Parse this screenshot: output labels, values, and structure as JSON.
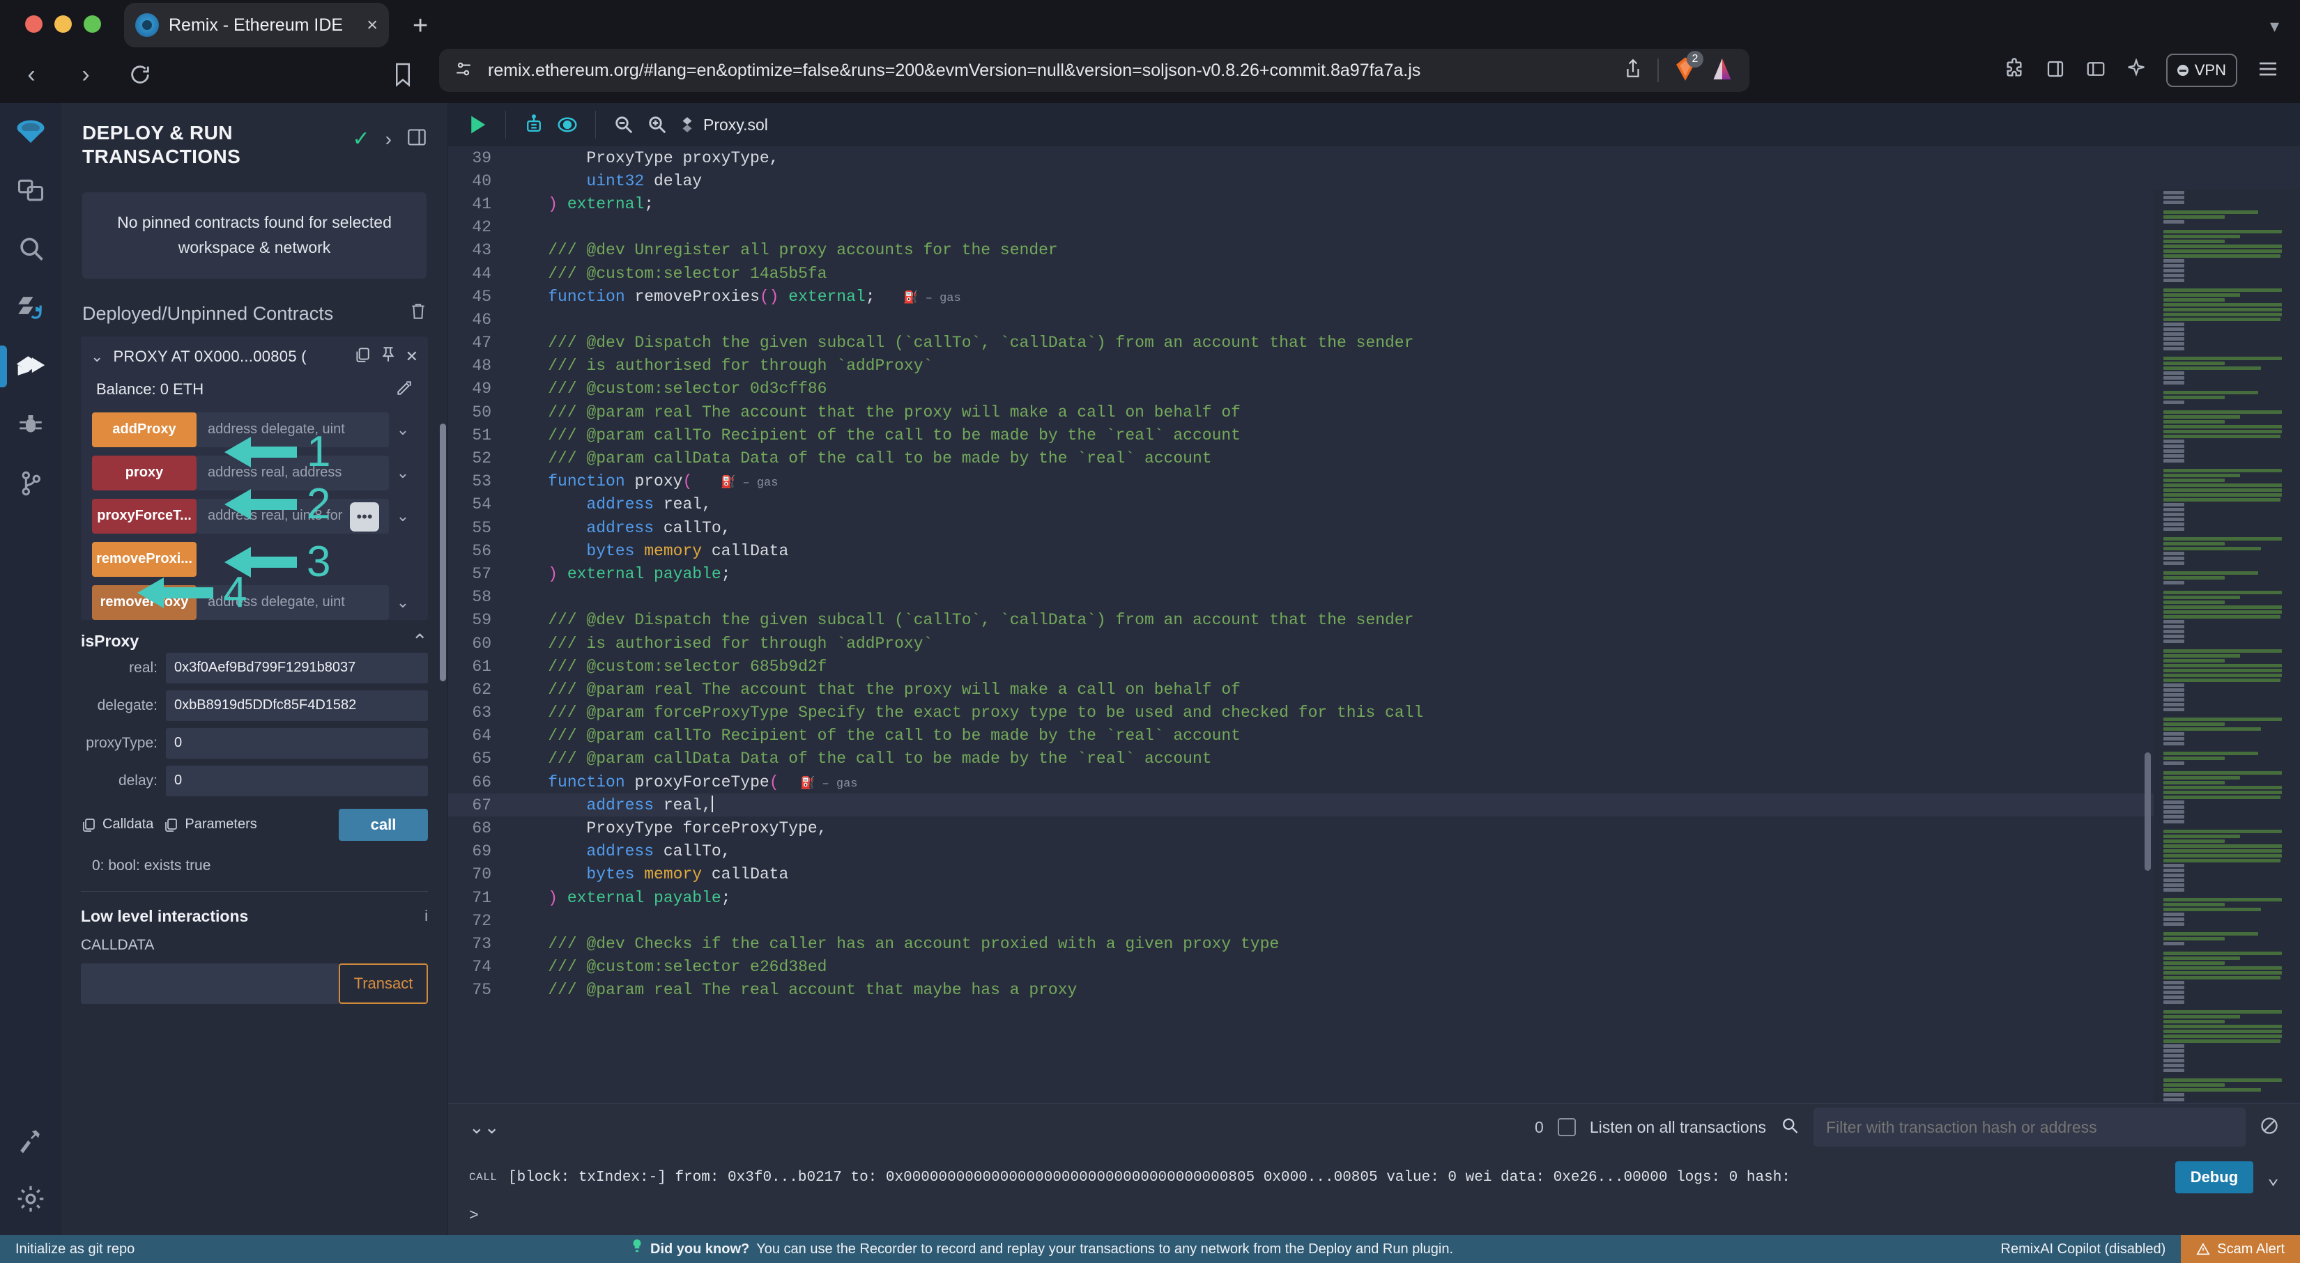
{
  "browser": {
    "tab": {
      "title": "Remix - Ethereum IDE",
      "favicon": "remix-logo-icon",
      "close": "×"
    },
    "new_tab": "+",
    "url": "remix.ethereum.org/#lang=en&optimize=false&runs=200&evmVersion=null&version=soljson-v0.8.26+commit.8a97fa7a.js",
    "extension_badge_count": "2",
    "vpn_label": "VPN"
  },
  "rail": {
    "items": [
      {
        "name": "remix-home-icon",
        "label": "Home"
      },
      {
        "name": "file-explorer-icon",
        "label": "File explorer"
      },
      {
        "name": "search-icon",
        "label": "Search in files"
      },
      {
        "name": "solidity-compiler-icon",
        "label": "Solidity compiler"
      },
      {
        "name": "deploy-run-icon",
        "label": "Deploy & run transactions"
      },
      {
        "name": "debugger-icon",
        "label": "Debugger"
      },
      {
        "name": "git-icon",
        "label": "Git"
      }
    ],
    "bottom": [
      {
        "name": "plugin-manager-icon",
        "label": "Plugin manager"
      },
      {
        "name": "settings-gear-icon",
        "label": "Settings"
      }
    ]
  },
  "panel": {
    "title": "DEPLOY & RUN TRANSACTIONS",
    "status_check": "✓",
    "expand_chevron": "›",
    "layout_icon": "panel-layout-icon",
    "pinned_message": "No pinned contracts found for selected workspace & network",
    "deployed_header": "Deployed/Unpinned Contracts",
    "contract": {
      "name": "PROXY AT 0X000...00805 (",
      "collapse_chevron": "⌄",
      "balance": "Balance: 0 ETH",
      "functions": [
        {
          "label": "addProxy",
          "color": "orange",
          "placeholder": "address delegate, uint",
          "has_input": true
        },
        {
          "label": "proxy",
          "color": "red",
          "placeholder": "address real, address",
          "has_input": true
        },
        {
          "label": "proxyForceT...",
          "color": "red",
          "placeholder": "address real, uint8 for",
          "has_input": true,
          "cursor": "•••"
        },
        {
          "label": "removeProxi...",
          "color": "orange",
          "placeholder": "",
          "has_input": false
        },
        {
          "label": "removeProxy",
          "color": "brown",
          "placeholder": "address delegate, uint",
          "has_input": true
        }
      ]
    },
    "isproxy": {
      "title": "isProxy",
      "collapse_chevron": "⌃",
      "params": [
        {
          "label": "real:",
          "value": "0x3f0Aef9Bd799F1291b8037"
        },
        {
          "label": "delegate:",
          "value": "0xbB8919d5DDfc85F4D1582"
        },
        {
          "label": "proxyType:",
          "value": "0"
        },
        {
          "label": "delay:",
          "value": "0"
        }
      ],
      "calldata_chip": "Calldata",
      "parameters_chip": "Parameters",
      "call_button": "call",
      "result": "0: bool: exists true"
    },
    "lowlevel": {
      "title": "Low level interactions",
      "info_icon": "i",
      "calldata_label": "CALLDATA",
      "calldata_value": "",
      "transact_button": "Transact"
    }
  },
  "editor": {
    "toolbar": {
      "run_icon": "play-run-icon",
      "ai_icon": "robot-ai-icon",
      "eye_icon": "eye-toggle-icon",
      "zoom_out_icon": "zoom-out-icon",
      "zoom_in_icon": "zoom-in-icon",
      "file_icon": "solidity-file-icon",
      "filename": "Proxy.sol"
    },
    "lines": [
      {
        "n": 39,
        "tokens": [
          {
            "t": "        ",
            "c": "id"
          },
          {
            "t": "ProxyType proxyType,",
            "c": "id"
          }
        ]
      },
      {
        "n": 40,
        "tokens": [
          {
            "t": "        ",
            "c": "id"
          },
          {
            "t": "uint32",
            "c": "kw"
          },
          {
            "t": " delay",
            "c": "id"
          }
        ]
      },
      {
        "n": 41,
        "tokens": [
          {
            "t": "    ",
            "c": "id"
          },
          {
            "t": ")",
            "c": "pk"
          },
          {
            "t": " external",
            "c": "gr"
          },
          {
            "t": ";",
            "c": "id"
          }
        ]
      },
      {
        "n": 42,
        "tokens": []
      },
      {
        "n": 43,
        "tokens": [
          {
            "t": "    /// @dev Unregister all proxy accounts for the sender",
            "c": "cm"
          }
        ]
      },
      {
        "n": 44,
        "tokens": [
          {
            "t": "    /// @custom:selector 14a5b5fa",
            "c": "cm"
          }
        ]
      },
      {
        "n": 45,
        "tokens": [
          {
            "t": "    ",
            "c": "id"
          },
          {
            "t": "function",
            "c": "kw"
          },
          {
            "t": " removeProxies",
            "c": "id"
          },
          {
            "t": "()",
            "c": "pk"
          },
          {
            "t": " external",
            "c": "gr"
          },
          {
            "t": ";",
            "c": "id"
          },
          {
            "t": "    ⛽ – gas",
            "c": "gas"
          }
        ]
      },
      {
        "n": 46,
        "tokens": []
      },
      {
        "n": 47,
        "tokens": [
          {
            "t": "    /// @dev Dispatch the given subcall (`callTo`, `callData`) from an account that the sender",
            "c": "cm"
          }
        ]
      },
      {
        "n": 48,
        "tokens": [
          {
            "t": "    /// is authorised for through `addProxy`",
            "c": "cm"
          }
        ]
      },
      {
        "n": 49,
        "tokens": [
          {
            "t": "    /// @custom:selector 0d3cff86",
            "c": "cm"
          }
        ]
      },
      {
        "n": 50,
        "tokens": [
          {
            "t": "    /// @param real The account that the proxy will make a call on behalf of",
            "c": "cm"
          }
        ]
      },
      {
        "n": 51,
        "tokens": [
          {
            "t": "    /// @param callTo Recipient of the call to be made by the `real` account",
            "c": "cm"
          }
        ]
      },
      {
        "n": 52,
        "tokens": [
          {
            "t": "    /// @param callData Data of the call to be made by the `real` account",
            "c": "cm"
          }
        ]
      },
      {
        "n": 53,
        "tokens": [
          {
            "t": "    ",
            "c": "id"
          },
          {
            "t": "function",
            "c": "kw"
          },
          {
            "t": " proxy",
            "c": "id"
          },
          {
            "t": "(",
            "c": "pk"
          },
          {
            "t": "    ⛽ – gas",
            "c": "gas"
          }
        ]
      },
      {
        "n": 54,
        "tokens": [
          {
            "t": "        ",
            "c": "id"
          },
          {
            "t": "address",
            "c": "kw"
          },
          {
            "t": " real,",
            "c": "id"
          }
        ]
      },
      {
        "n": 55,
        "tokens": [
          {
            "t": "        ",
            "c": "id"
          },
          {
            "t": "address",
            "c": "kw"
          },
          {
            "t": " callTo,",
            "c": "id"
          }
        ]
      },
      {
        "n": 56,
        "tokens": [
          {
            "t": "        ",
            "c": "id"
          },
          {
            "t": "bytes",
            "c": "kw"
          },
          {
            "t": " memory",
            "c": "or"
          },
          {
            "t": " callData",
            "c": "id"
          }
        ]
      },
      {
        "n": 57,
        "tokens": [
          {
            "t": "    ",
            "c": "id"
          },
          {
            "t": ")",
            "c": "pk"
          },
          {
            "t": " external payable",
            "c": "gr"
          },
          {
            "t": ";",
            "c": "id"
          }
        ]
      },
      {
        "n": 58,
        "tokens": []
      },
      {
        "n": 59,
        "tokens": [
          {
            "t": "    /// @dev Dispatch the given subcall (`callTo`, `callData`) from an account that the sender",
            "c": "cm"
          }
        ]
      },
      {
        "n": 60,
        "tokens": [
          {
            "t": "    /// is authorised for through `addProxy`",
            "c": "cm"
          }
        ]
      },
      {
        "n": 61,
        "tokens": [
          {
            "t": "    /// @custom:selector 685b9d2f",
            "c": "cm"
          }
        ]
      },
      {
        "n": 62,
        "tokens": [
          {
            "t": "    /// @param real The account that the proxy will make a call on behalf of",
            "c": "cm"
          }
        ]
      },
      {
        "n": 63,
        "tokens": [
          {
            "t": "    /// @param forceProxyType Specify the exact proxy type to be used and checked for this call",
            "c": "cm"
          }
        ]
      },
      {
        "n": 64,
        "tokens": [
          {
            "t": "    /// @param callTo Recipient of the call to be made by the `real` account",
            "c": "cm"
          }
        ]
      },
      {
        "n": 65,
        "tokens": [
          {
            "t": "    /// @param callData Data of the call to be made by the `real` account",
            "c": "cm"
          }
        ]
      },
      {
        "n": 66,
        "tokens": [
          {
            "t": "    ",
            "c": "id"
          },
          {
            "t": "function",
            "c": "kw"
          },
          {
            "t": " proxyForceType",
            "c": "id"
          },
          {
            "t": "(",
            "c": "pk"
          },
          {
            "t": "   ⛽ – gas",
            "c": "gas"
          }
        ]
      },
      {
        "n": 67,
        "tokens": [
          {
            "t": "        ",
            "c": "id"
          },
          {
            "t": "address",
            "c": "kw"
          },
          {
            "t": " real,",
            "c": "id"
          }
        ],
        "highlight": true,
        "caret": true
      },
      {
        "n": 68,
        "tokens": [
          {
            "t": "        ",
            "c": "id"
          },
          {
            "t": "ProxyType forceProxyType,",
            "c": "id"
          }
        ]
      },
      {
        "n": 69,
        "tokens": [
          {
            "t": "        ",
            "c": "id"
          },
          {
            "t": "address",
            "c": "kw"
          },
          {
            "t": " callTo,",
            "c": "id"
          }
        ]
      },
      {
        "n": 70,
        "tokens": [
          {
            "t": "        ",
            "c": "id"
          },
          {
            "t": "bytes",
            "c": "kw"
          },
          {
            "t": " memory",
            "c": "or"
          },
          {
            "t": " callData",
            "c": "id"
          }
        ]
      },
      {
        "n": 71,
        "tokens": [
          {
            "t": "    ",
            "c": "id"
          },
          {
            "t": ")",
            "c": "pk"
          },
          {
            "t": " external payable",
            "c": "gr"
          },
          {
            "t": ";",
            "c": "id"
          }
        ]
      },
      {
        "n": 72,
        "tokens": []
      },
      {
        "n": 73,
        "tokens": [
          {
            "t": "    /// @dev Checks if the caller has an account proxied with a given proxy type",
            "c": "cm"
          }
        ]
      },
      {
        "n": 74,
        "tokens": [
          {
            "t": "    /// @custom:selector e26d38ed",
            "c": "cm"
          }
        ]
      },
      {
        "n": 75,
        "tokens": [
          {
            "t": "    /// @param real The real account that maybe has a proxy",
            "c": "cm"
          }
        ]
      }
    ]
  },
  "terminal": {
    "chevrons": "⌄⌄",
    "tx_count": "0",
    "listen_label": "Listen on all transactions",
    "search_icon": "search-icon",
    "filter_placeholder": "Filter with transaction hash or address",
    "clear_icon": "clear-console-icon",
    "log": {
      "kind": "CALL",
      "text": "[block: txIndex:-] from: 0x3f0...b0217 to: 0x0000000000000000000000000000000000000805 0x000...00805 value: 0 wei data: 0xe26...00000 logs: 0 hash:",
      "debug_button": "Debug",
      "expand_chevron": "⌄"
    },
    "prompt": ">"
  },
  "status": {
    "git_label": "Initialize as git repo",
    "tip_bulb": "lightbulb-icon",
    "tip_title": "Did you know?",
    "tip_text": "You can use the Recorder to record and replay your transactions to any network from the Deploy and Run plugin.",
    "copilot": "RemixAI Copilot (disabled)",
    "scam_alert": "Scam Alert",
    "scam_icon": "warning-triangle-icon"
  },
  "annotations": [
    {
      "number": "1",
      "target": "code-line-63"
    },
    {
      "number": "2",
      "target": "code-line-68"
    },
    {
      "number": "3",
      "target": "code-line-73"
    },
    {
      "number": "4",
      "target": "isproxy-result"
    }
  ],
  "colors": {
    "accent_teal": "#45c9be",
    "call_blue": "#3d7ea6",
    "orange": "#e08b3d",
    "red": "#99333c",
    "brown": "#b5703d",
    "transact_orange": "#d08a3c",
    "status_bar": "#2f5a74",
    "scam_orange": "#c97a35",
    "debug_blue": "#1b7bab",
    "check_green": "#2ecc8f"
  }
}
